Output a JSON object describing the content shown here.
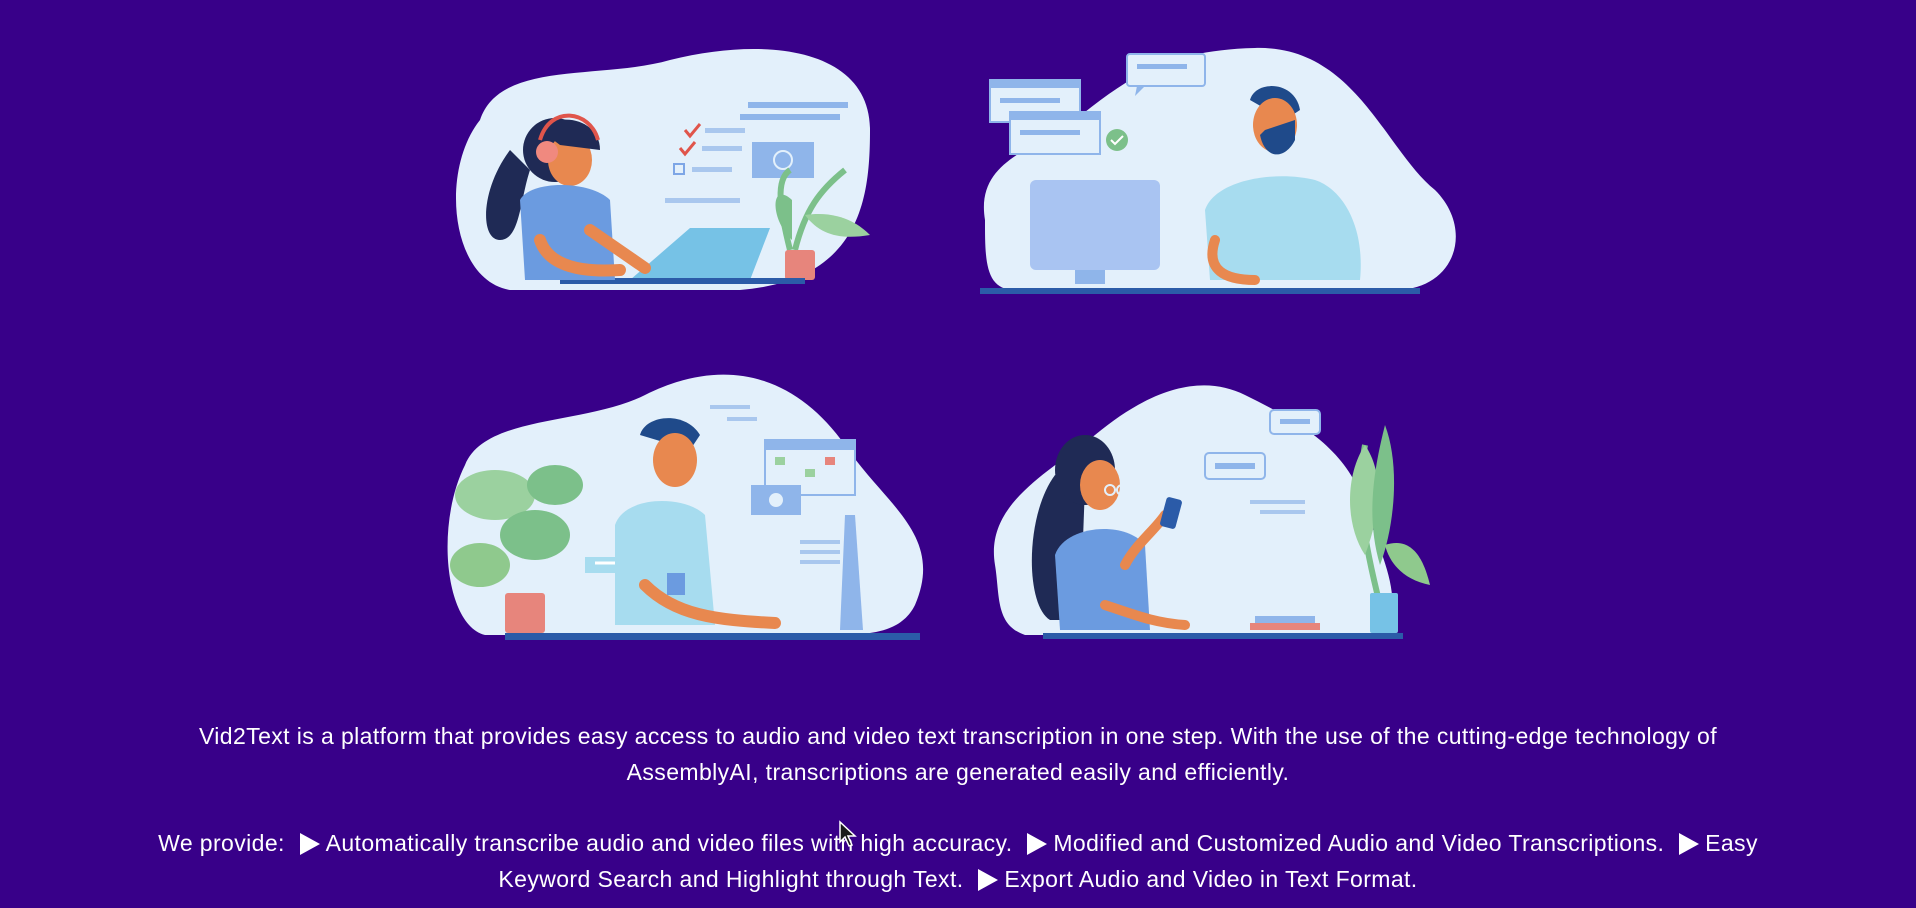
{
  "illustrations": [
    {
      "subject": "woman-with-headset-laptop"
    },
    {
      "subject": "man-at-desktop-chat"
    },
    {
      "subject": "man-with-plant-monitor"
    },
    {
      "subject": "woman-with-phone-plant"
    }
  ],
  "colors": {
    "background": "#380089",
    "blob": "#e3f0fb",
    "accent_blue": "#6b9be0",
    "plant_green": "#7cc08a",
    "skin": "#e8884f",
    "hair": "#1f2a55",
    "text": "#ffffff"
  },
  "description": "Vid2Text is a platform that provides easy access to audio and video text transcription in one step. With the use of the cutting-edge technology of AssemblyAI, transcriptions are generated easily and efficiently.",
  "provide": {
    "intro": "We provide:",
    "features": [
      "Automatically transcribe audio and video files with high accuracy.",
      "Modified and Customized Audio and Video Transcriptions.",
      "Easy Keyword Search and Highlight through Text.",
      "Export Audio and Video in Text Format."
    ],
    "bullet_icon": "play-arrow-icon"
  }
}
